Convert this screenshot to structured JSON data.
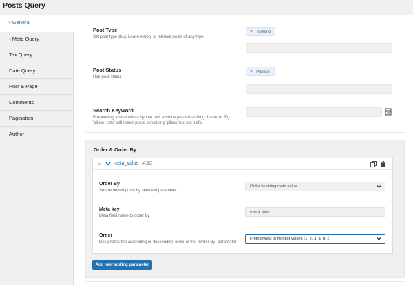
{
  "page_title": "Posts Query",
  "sidebar": {
    "items": [
      {
        "label": "• General",
        "active": true
      },
      {
        "label": "• Meta Query"
      },
      {
        "label": "Tax Query"
      },
      {
        "label": "Date Query"
      },
      {
        "label": "Post & Page"
      },
      {
        "label": "Comments"
      },
      {
        "label": "Pagination"
      },
      {
        "label": "Author"
      }
    ]
  },
  "fields": {
    "post_type": {
      "label": "Post Type",
      "desc": "Set post type slug. Leave empty to retrieve posts of any type",
      "chip": "Termine"
    },
    "post_status": {
      "label": "Post Status",
      "desc": "Use post status",
      "chip": "Publish"
    },
    "search_keyword": {
      "label": "Search Keyword",
      "desc_line1": "Prepending a term with a hyphen will exclude posts matching that term. Eg,",
      "desc_line2": "'pillow -sofa' will return posts containing 'pillow' but not 'sofa'",
      "value": ""
    }
  },
  "order_section": {
    "title": "Order & Order By",
    "item": {
      "field": "meta_value",
      "direction": "ASC",
      "order_by": {
        "label": "Order By",
        "desc": "Sort retrieved posts by selected parameter",
        "value": "Order by string meta value"
      },
      "meta_key": {
        "label": "Meta key",
        "desc": "Meta field name to order by",
        "value": "event_date"
      },
      "order": {
        "label": "Order",
        "desc": "Designates the ascending or descending order of the `Order By` parameter",
        "value": "From lowest to highest values (1, 2, 3; a, b, c)"
      }
    },
    "add_button": "Add new sorting parameter"
  },
  "icons": {
    "close": "×",
    "drag": "≡",
    "chevron": "⌄"
  },
  "colors": {
    "accent": "#2271b1"
  }
}
